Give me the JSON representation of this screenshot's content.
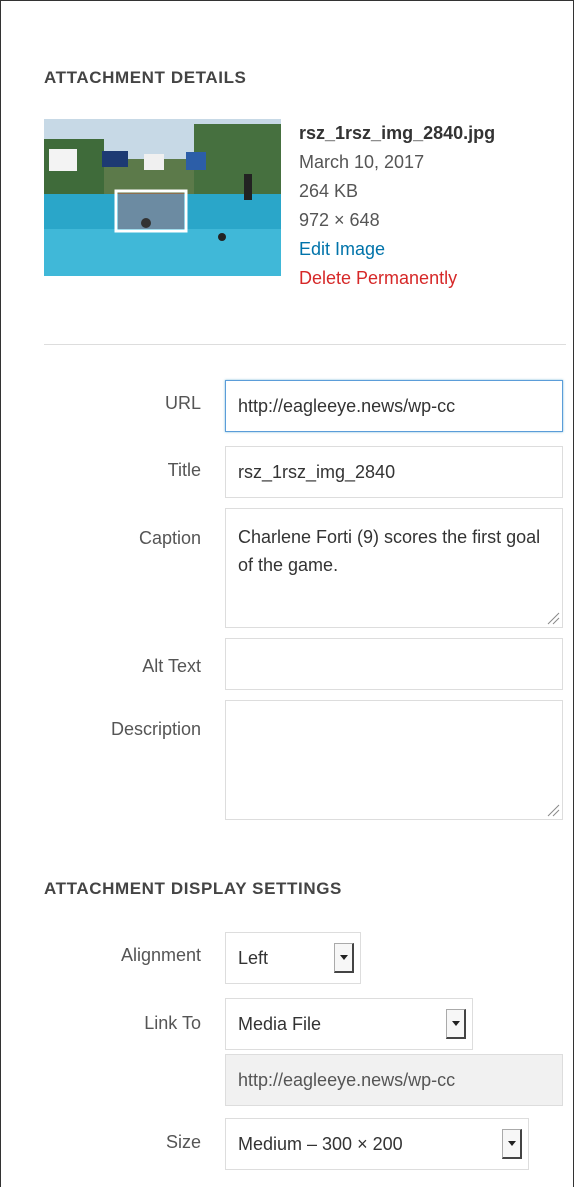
{
  "details": {
    "heading": "ATTACHMENT DETAILS",
    "filename": "rsz_1rsz_img_2840.jpg",
    "date": "March 10, 2017",
    "filesize": "264 KB",
    "dimensions": "972 × 648",
    "edit_label": "Edit Image",
    "delete_label": "Delete Permanently",
    "link_color": "#0073aa",
    "delete_color": "#d62828"
  },
  "fields": {
    "url_label": "URL",
    "url_value": "http://eagleeye.news/wp-cc",
    "title_label": "Title",
    "title_value": "rsz_1rsz_img_2840",
    "caption_label": "Caption",
    "caption_value": "Charlene Forti (9) scores the first goal of the game.",
    "alt_label": "Alt Text",
    "alt_value": "",
    "description_label": "Description",
    "description_value": ""
  },
  "display": {
    "heading": "ATTACHMENT DISPLAY SETTINGS",
    "alignment_label": "Alignment",
    "alignment_value": "Left",
    "link_to_label": "Link To",
    "link_to_value": "Media File",
    "link_url_value": "http://eagleeye.news/wp-cc",
    "size_label": "Size",
    "size_value": "Medium – 300 × 200"
  }
}
